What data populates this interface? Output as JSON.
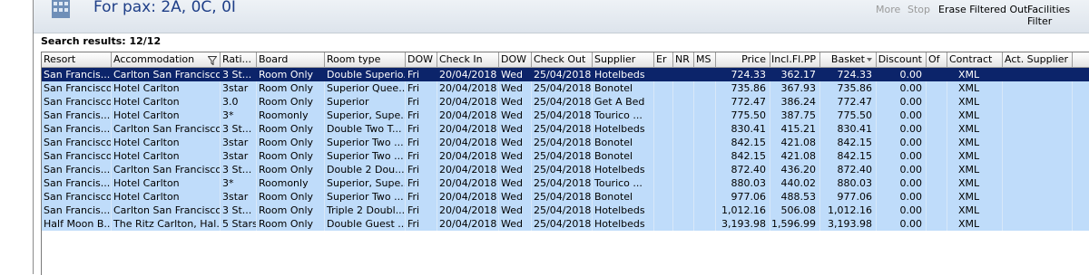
{
  "header": {
    "title": "For pax: 2A, 0C, 0I",
    "actions": [
      {
        "label": "More",
        "enabled": false
      },
      {
        "label": "Stop",
        "enabled": false
      },
      {
        "label": "Erase Filtered Out",
        "enabled": true
      },
      {
        "label": "Facilities Filter",
        "enabled": true
      }
    ]
  },
  "results_label": "Search results: 12/12",
  "table": {
    "columns": [
      "Resort",
      "Accommodation",
      "Rati...",
      "Board",
      "Room type",
      "DOW",
      "Check In",
      "DOW",
      "Check Out",
      "Supplier",
      "Er",
      "NR",
      "MS",
      "Price",
      "Incl.Fl.PP",
      "Basket",
      "Discount",
      "Of",
      "Contract",
      "Act. Supplier"
    ],
    "rows": [
      [
        "San Francis...",
        "Carlton San Francisco",
        "3 St...",
        "Room Only",
        "Double Superio...",
        "Fri",
        "20/04/2018",
        "Wed",
        "25/04/2018",
        "Hotelbeds",
        "",
        "",
        "",
        "724.33",
        "362.17",
        "724.33",
        "0.00",
        "",
        "XML",
        ""
      ],
      [
        "San Francisco",
        "Hotel Carlton",
        "3star",
        "Room Only",
        "Superior Quee...",
        "Fri",
        "20/04/2018",
        "Wed",
        "25/04/2018",
        "Bonotel",
        "",
        "",
        "",
        "735.86",
        "367.93",
        "735.86",
        "0.00",
        "",
        "XML",
        ""
      ],
      [
        "San Francisco",
        "Hotel Carlton",
        "3.0",
        "Room Only",
        "Superior",
        "Fri",
        "20/04/2018",
        "Wed",
        "25/04/2018",
        "Get A Bed",
        "",
        "",
        "",
        "772.47",
        "386.24",
        "772.47",
        "0.00",
        "",
        "XML",
        ""
      ],
      [
        "San Francis...",
        "Hotel Carlton",
        "3*",
        "Roomonly",
        "Superior, Supe...",
        "Fri",
        "20/04/2018",
        "Wed",
        "25/04/2018",
        "Tourico ...",
        "",
        "",
        "",
        "775.50",
        "387.75",
        "775.50",
        "0.00",
        "",
        "XML",
        ""
      ],
      [
        "San Francis...",
        "Carlton San Francisco",
        "3 St...",
        "Room Only",
        "Double Two T...",
        "Fri",
        "20/04/2018",
        "Wed",
        "25/04/2018",
        "Hotelbeds",
        "",
        "",
        "",
        "830.41",
        "415.21",
        "830.41",
        "0.00",
        "",
        "XML",
        ""
      ],
      [
        "San Francisco",
        "Hotel Carlton",
        "3star",
        "Room Only",
        "Superior Two ...",
        "Fri",
        "20/04/2018",
        "Wed",
        "25/04/2018",
        "Bonotel",
        "",
        "",
        "",
        "842.15",
        "421.08",
        "842.15",
        "0.00",
        "",
        "XML",
        ""
      ],
      [
        "San Francisco",
        "Hotel Carlton",
        "3star",
        "Room Only",
        "Superior Two ...",
        "Fri",
        "20/04/2018",
        "Wed",
        "25/04/2018",
        "Bonotel",
        "",
        "",
        "",
        "842.15",
        "421.08",
        "842.15",
        "0.00",
        "",
        "XML",
        ""
      ],
      [
        "San Francis...",
        "Carlton San Francisco",
        "3 St...",
        "Room Only",
        "Double 2 Dou...",
        "Fri",
        "20/04/2018",
        "Wed",
        "25/04/2018",
        "Hotelbeds",
        "",
        "",
        "",
        "872.40",
        "436.20",
        "872.40",
        "0.00",
        "",
        "XML",
        ""
      ],
      [
        "San Francis...",
        "Hotel Carlton",
        "3*",
        "Roomonly",
        "Superior, Supe...",
        "Fri",
        "20/04/2018",
        "Wed",
        "25/04/2018",
        "Tourico ...",
        "",
        "",
        "",
        "880.03",
        "440.02",
        "880.03",
        "0.00",
        "",
        "XML",
        ""
      ],
      [
        "San Francisco",
        "Hotel Carlton",
        "3star",
        "Room Only",
        "Superior Two ...",
        "Fri",
        "20/04/2018",
        "Wed",
        "25/04/2018",
        "Bonotel",
        "",
        "",
        "",
        "977.06",
        "488.53",
        "977.06",
        "0.00",
        "",
        "XML",
        ""
      ],
      [
        "San Francis...",
        "Carlton San Francisco",
        "3 St...",
        "Room Only",
        "Triple 2 Doubl...",
        "Fri",
        "20/04/2018",
        "Wed",
        "25/04/2018",
        "Hotelbeds",
        "",
        "",
        "",
        "1,012.16",
        "506.08",
        "1,012.16",
        "0.00",
        "",
        "XML",
        ""
      ],
      [
        "Half Moon B...",
        "The Ritz Carlton, Hal...",
        "5 Stars",
        "Room Only",
        "Double Guest ...",
        "Fri",
        "20/04/2018",
        "Wed",
        "25/04/2018",
        "Hotelbeds",
        "",
        "",
        "",
        "3,193.98",
        "1,596.99",
        "3,193.98",
        "0.00",
        "",
        "XML",
        ""
      ]
    ],
    "selected_row": 0
  },
  "colors": {
    "row_bg": "#bfdcfa",
    "selected_bg": "#0c246a",
    "title": "#1f3f88"
  }
}
